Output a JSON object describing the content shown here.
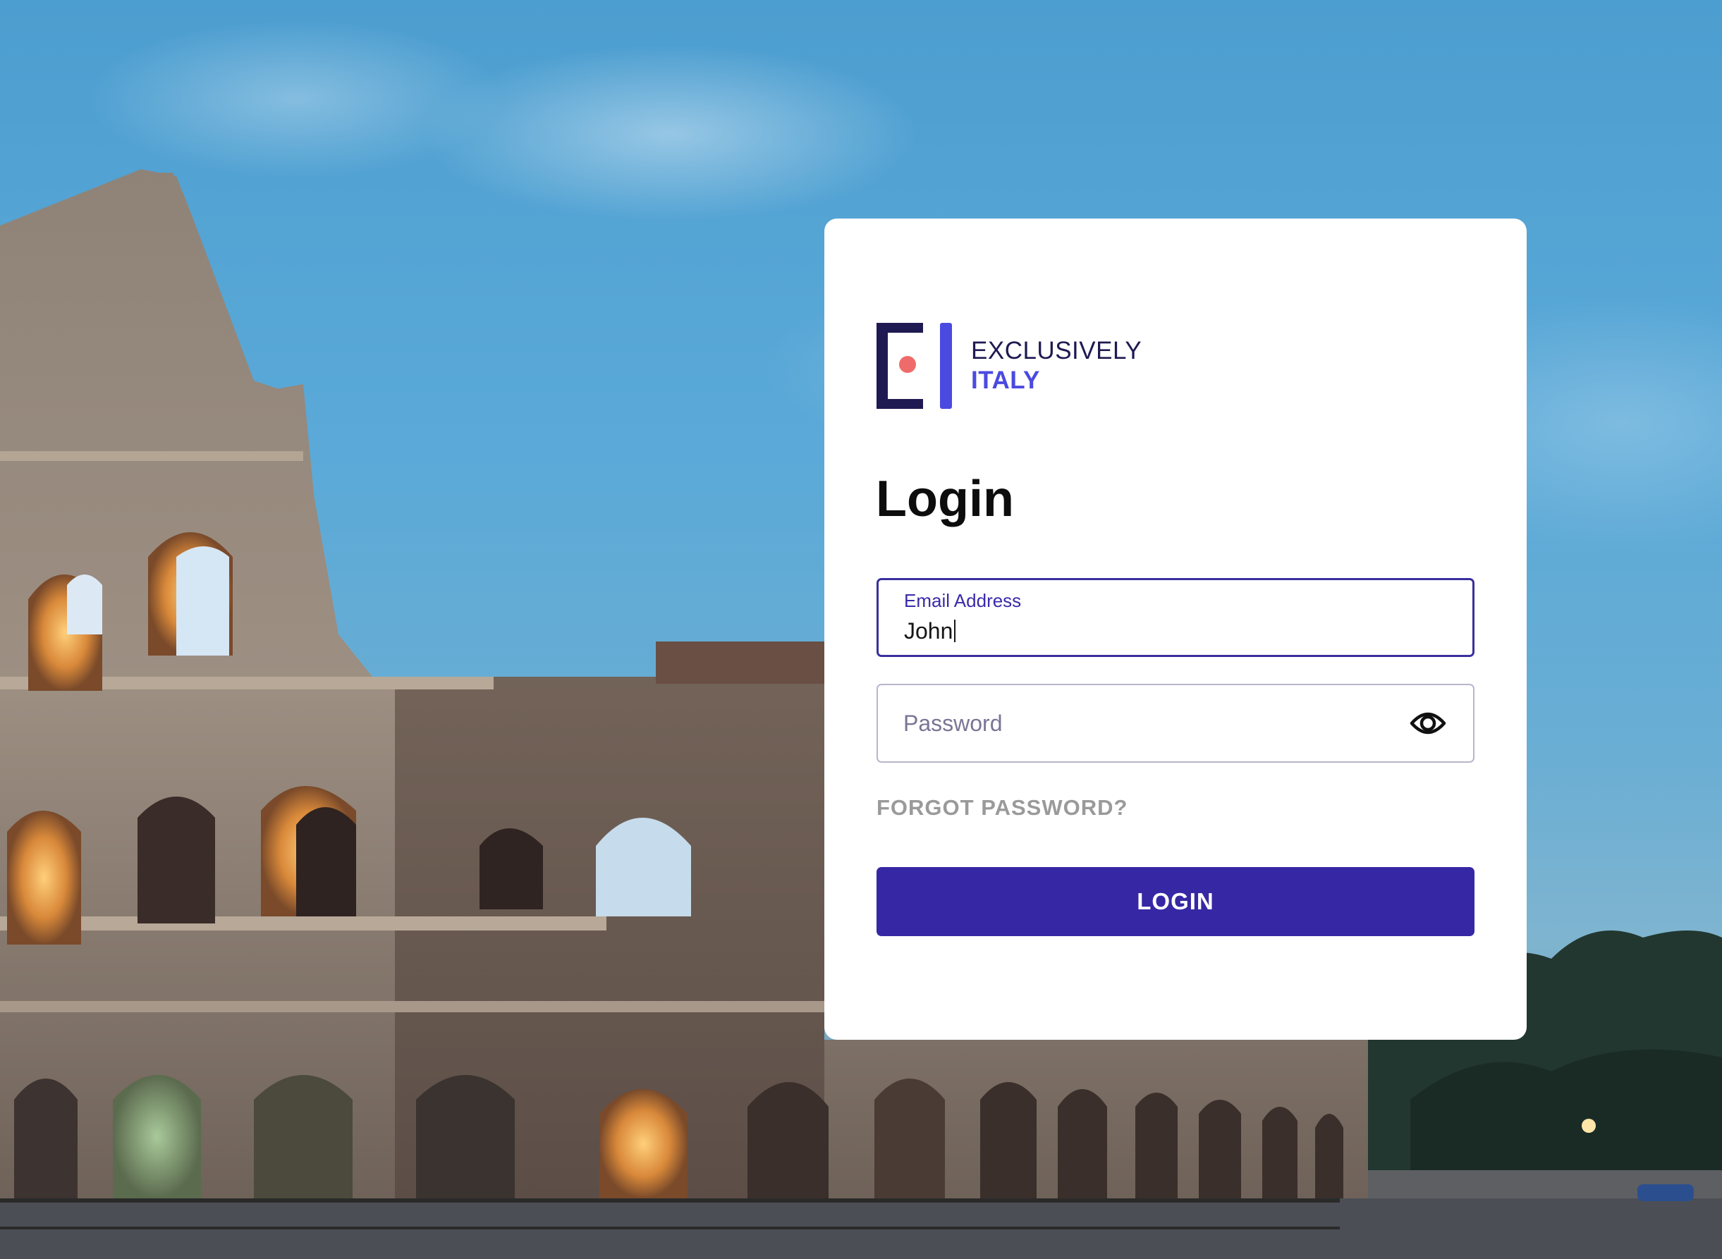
{
  "brand": {
    "line1": "EXCLUSIVELY",
    "line2": "ITALY",
    "colors": {
      "dark": "#1f1a52",
      "accent": "#4b4ae0",
      "dot": "#ef6b6b"
    }
  },
  "login": {
    "title": "Login",
    "email": {
      "label": "Email Address",
      "value": "John"
    },
    "password": {
      "placeholder": "Password",
      "toggle_icon": "eye-icon"
    },
    "forgot_label": "FORGOT PASSWORD?",
    "submit_label": "LOGIN",
    "colors": {
      "primary": "#3628a4",
      "focus_border": "#3a2f9e"
    }
  },
  "background": {
    "subject": "colosseum-photo"
  }
}
